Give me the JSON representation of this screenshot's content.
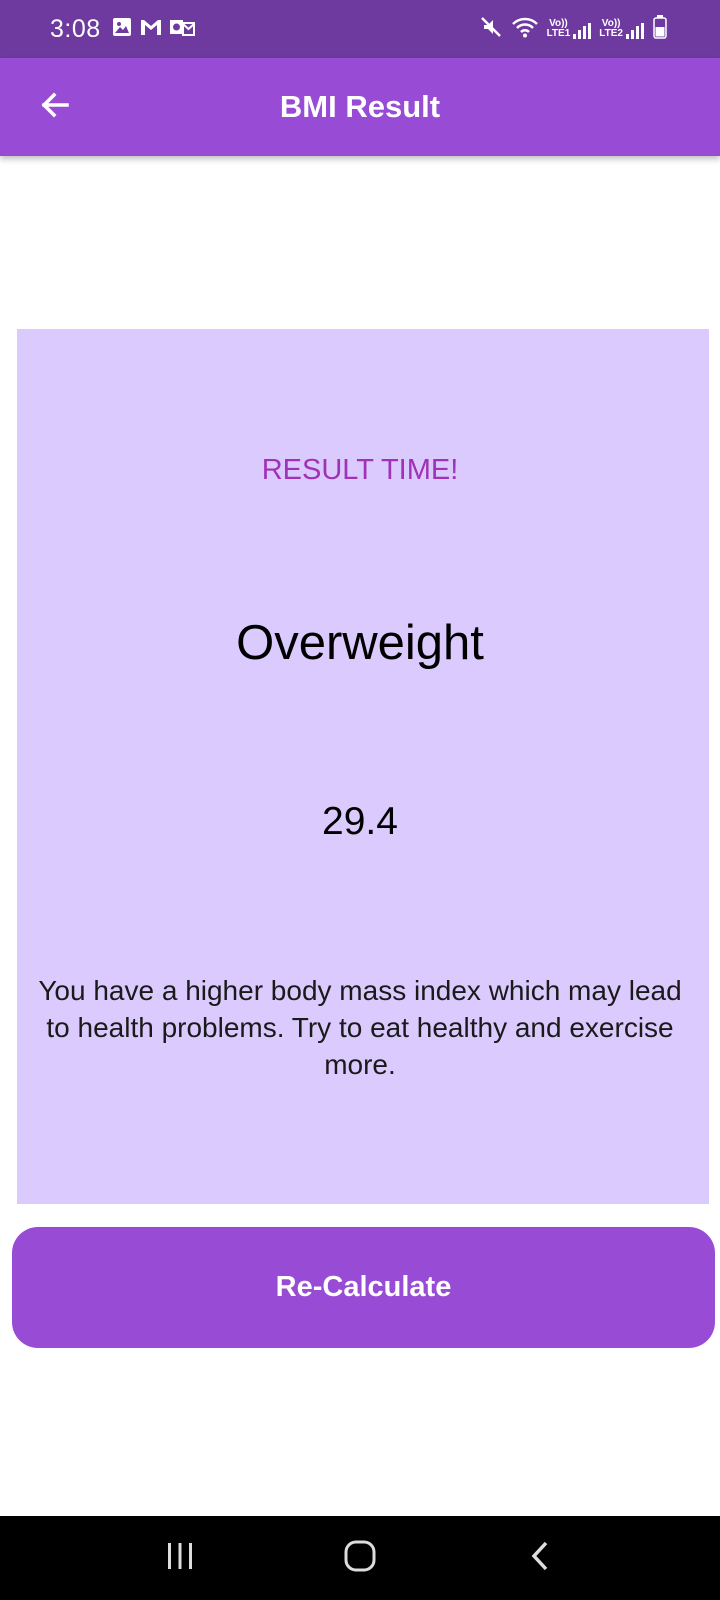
{
  "status_bar": {
    "time": "3:08",
    "sim1_label_top": "Vo))",
    "sim1_label_bottom": "LTE1",
    "sim2_label_top": "Vo))",
    "sim2_label_bottom": "LTE2",
    "icons": [
      "image-icon",
      "gmail-icon",
      "outlook-icon",
      "mute-icon",
      "wifi-icon",
      "signal-icon",
      "signal-icon",
      "battery-icon"
    ]
  },
  "app_bar": {
    "title": "BMI Result",
    "back_icon": "arrow-left-icon"
  },
  "result": {
    "label": "RESULT TIME!",
    "category": "Overweight",
    "value": "29.4",
    "advice": "You have a higher body mass index which may lead to health problems. Try to eat healthy and exercise more."
  },
  "actions": {
    "recalculate_label": "Re-Calculate"
  },
  "nav": {
    "icons": [
      "recent-apps-icon",
      "home-icon",
      "back-icon"
    ]
  },
  "colors": {
    "status_bar": "#6f3aa0",
    "app_bar": "#984cd5",
    "card": "#dbcafe",
    "accent_text": "#a033b5",
    "button": "#984cd5"
  }
}
